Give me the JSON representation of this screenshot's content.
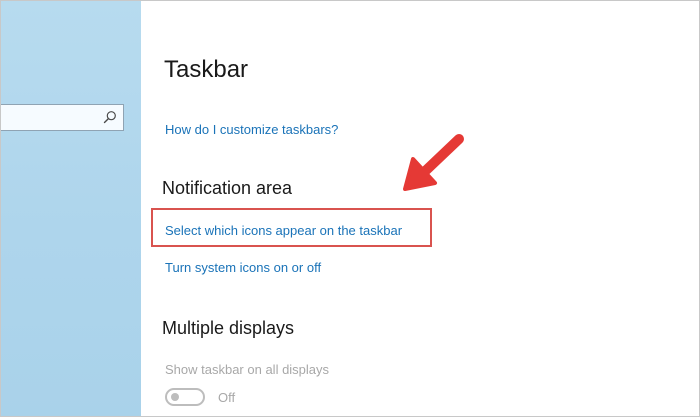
{
  "page": {
    "title": "Taskbar"
  },
  "links": {
    "customize": "How do I customize taskbars?",
    "select_icons": "Select which icons appear on the taskbar",
    "system_icons": "Turn system icons on or off"
  },
  "sections": {
    "notification_area": "Notification area",
    "multiple_displays": "Multiple displays"
  },
  "settings": {
    "show_taskbar_all_displays": {
      "label": "Show taskbar on all displays",
      "state": "Off",
      "enabled": false
    }
  },
  "annotations": {
    "highlight_color": "#d9534f",
    "arrow_color": "#e53935"
  },
  "icons": {
    "search": "search-icon",
    "arrow": "red-arrow-icon"
  },
  "colors": {
    "sidebar": "#b1d7ed",
    "link": "#1a73b8",
    "disabled_text": "#a8a8a8"
  }
}
